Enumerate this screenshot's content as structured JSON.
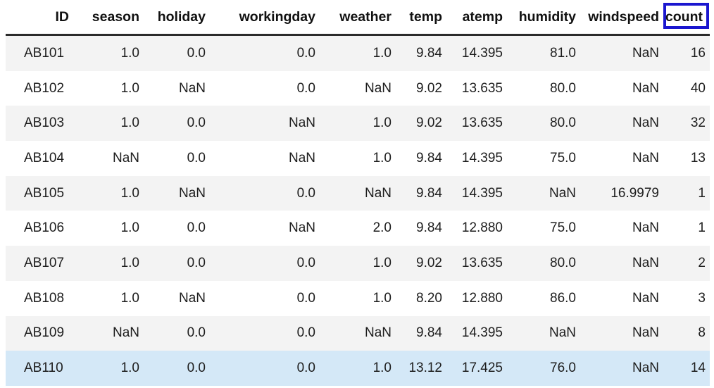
{
  "table": {
    "columns": [
      {
        "key": "id",
        "label": "ID",
        "highlighted": false
      },
      {
        "key": "season",
        "label": "season",
        "highlighted": false
      },
      {
        "key": "holiday",
        "label": "holiday",
        "highlighted": false
      },
      {
        "key": "workingday",
        "label": "workingday",
        "highlighted": false
      },
      {
        "key": "weather",
        "label": "weather",
        "highlighted": false
      },
      {
        "key": "temp",
        "label": "temp",
        "highlighted": false
      },
      {
        "key": "atemp",
        "label": "atemp",
        "highlighted": false
      },
      {
        "key": "humidity",
        "label": "humidity",
        "highlighted": false
      },
      {
        "key": "windspeed",
        "label": "windspeed",
        "highlighted": false
      },
      {
        "key": "count",
        "label": "count",
        "highlighted": true
      }
    ],
    "highlight_color": "#1a16cf",
    "selected_row_color": "#d4e8f7",
    "stripe_color": "#f3f3f3",
    "rows": [
      {
        "id": "AB101",
        "season": "1.0",
        "holiday": "0.0",
        "workingday": "0.0",
        "weather": "1.0",
        "temp": "9.84",
        "atemp": "14.395",
        "humidity": "81.0",
        "windspeed": "NaN",
        "count": "16",
        "selected": false
      },
      {
        "id": "AB102",
        "season": "1.0",
        "holiday": "NaN",
        "workingday": "0.0",
        "weather": "NaN",
        "temp": "9.02",
        "atemp": "13.635",
        "humidity": "80.0",
        "windspeed": "NaN",
        "count": "40",
        "selected": false
      },
      {
        "id": "AB103",
        "season": "1.0",
        "holiday": "0.0",
        "workingday": "NaN",
        "weather": "1.0",
        "temp": "9.02",
        "atemp": "13.635",
        "humidity": "80.0",
        "windspeed": "NaN",
        "count": "32",
        "selected": false
      },
      {
        "id": "AB104",
        "season": "NaN",
        "holiday": "0.0",
        "workingday": "NaN",
        "weather": "1.0",
        "temp": "9.84",
        "atemp": "14.395",
        "humidity": "75.0",
        "windspeed": "NaN",
        "count": "13",
        "selected": false
      },
      {
        "id": "AB105",
        "season": "1.0",
        "holiday": "NaN",
        "workingday": "0.0",
        "weather": "NaN",
        "temp": "9.84",
        "atemp": "14.395",
        "humidity": "NaN",
        "windspeed": "16.9979",
        "count": "1",
        "selected": false
      },
      {
        "id": "AB106",
        "season": "1.0",
        "holiday": "0.0",
        "workingday": "NaN",
        "weather": "2.0",
        "temp": "9.84",
        "atemp": "12.880",
        "humidity": "75.0",
        "windspeed": "NaN",
        "count": "1",
        "selected": false
      },
      {
        "id": "AB107",
        "season": "1.0",
        "holiday": "0.0",
        "workingday": "0.0",
        "weather": "1.0",
        "temp": "9.02",
        "atemp": "13.635",
        "humidity": "80.0",
        "windspeed": "NaN",
        "count": "2",
        "selected": false
      },
      {
        "id": "AB108",
        "season": "1.0",
        "holiday": "NaN",
        "workingday": "0.0",
        "weather": "1.0",
        "temp": "8.20",
        "atemp": "12.880",
        "humidity": "86.0",
        "windspeed": "NaN",
        "count": "3",
        "selected": false
      },
      {
        "id": "AB109",
        "season": "NaN",
        "holiday": "0.0",
        "workingday": "0.0",
        "weather": "NaN",
        "temp": "9.84",
        "atemp": "14.395",
        "humidity": "NaN",
        "windspeed": "NaN",
        "count": "8",
        "selected": false
      },
      {
        "id": "AB110",
        "season": "1.0",
        "holiday": "0.0",
        "workingday": "0.0",
        "weather": "1.0",
        "temp": "13.12",
        "atemp": "17.425",
        "humidity": "76.0",
        "windspeed": "NaN",
        "count": "14",
        "selected": true
      }
    ]
  }
}
